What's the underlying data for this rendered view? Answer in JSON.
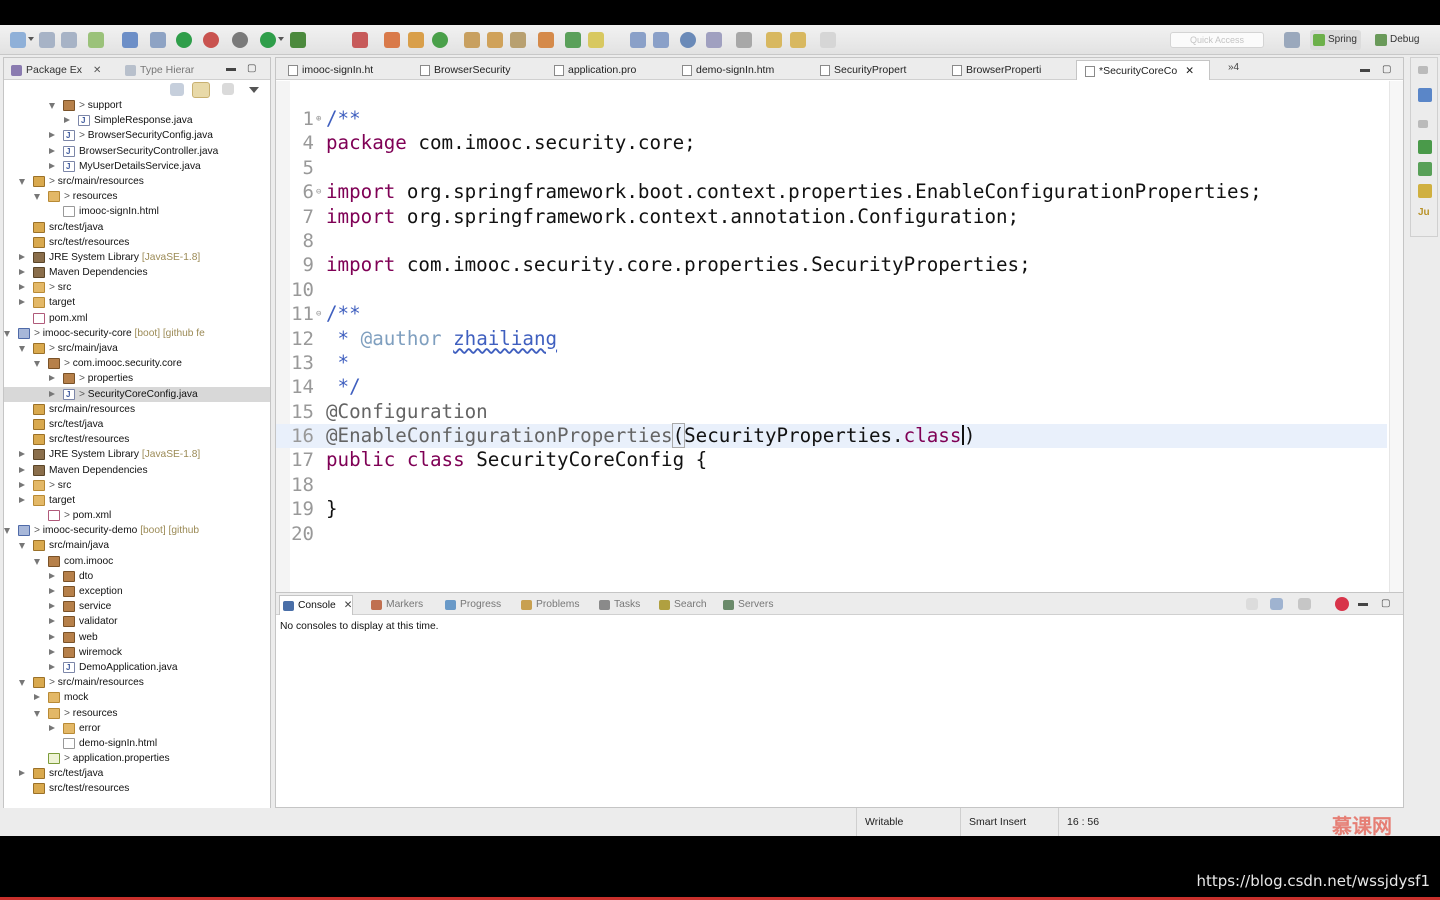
{
  "toolbar": {
    "quick_access_placeholder": "Quick Access",
    "perspectives": [
      {
        "label": "Spring",
        "icon": "spring-leaf-icon"
      },
      {
        "label": "Debug",
        "icon": "bug-icon"
      }
    ]
  },
  "package_explorer": {
    "tabs": [
      {
        "label": "Package Ex",
        "icon": "package-explorer-icon",
        "active": true
      },
      {
        "label": "Type Hierar",
        "icon": "type-hierarchy-icon",
        "active": false
      }
    ],
    "tree": [
      {
        "label": "support",
        "prefix": ">",
        "icon": "package",
        "twisty": "open",
        "level": 5,
        "sel": false,
        "decoration": ""
      },
      {
        "label": "SimpleResponse.java",
        "prefix": "",
        "icon": "java",
        "twisty": "closed",
        "level": 6,
        "sel": false,
        "decoration": ""
      },
      {
        "label": "BrowserSecurityConfig.java",
        "prefix": ">",
        "icon": "java",
        "twisty": "closed",
        "level": 5,
        "sel": false,
        "decoration": ""
      },
      {
        "label": "BrowserSecurityController.java",
        "prefix": "",
        "icon": "java",
        "twisty": "closed",
        "level": 5,
        "sel": false,
        "decoration": ""
      },
      {
        "label": "MyUserDetailsService.java",
        "prefix": "",
        "icon": "java",
        "twisty": "closed",
        "level": 5,
        "sel": false,
        "decoration": ""
      },
      {
        "label": "src/main/resources",
        "prefix": ">",
        "icon": "srcfolder",
        "twisty": "open",
        "level": 3,
        "sel": false,
        "decoration": ""
      },
      {
        "label": "resources",
        "prefix": ">",
        "icon": "folder",
        "twisty": "open",
        "level": 4,
        "sel": false,
        "decoration": ""
      },
      {
        "label": "imooc-signIn.html",
        "prefix": "",
        "icon": "html",
        "twisty": "",
        "level": 5,
        "sel": false,
        "decoration": ""
      },
      {
        "label": "src/test/java",
        "prefix": "",
        "icon": "srcfolder",
        "twisty": "",
        "level": 3,
        "sel": false,
        "decoration": ""
      },
      {
        "label": "src/test/resources",
        "prefix": "",
        "icon": "srcfolder",
        "twisty": "",
        "level": 3,
        "sel": false,
        "decoration": ""
      },
      {
        "label": "JRE System Library",
        "prefix": "",
        "icon": "library",
        "twisty": "closed",
        "level": 3,
        "sel": false,
        "decoration": "[JavaSE-1.8]"
      },
      {
        "label": "Maven Dependencies",
        "prefix": "",
        "icon": "library",
        "twisty": "closed",
        "level": 3,
        "sel": false,
        "decoration": ""
      },
      {
        "label": "src",
        "prefix": ">",
        "icon": "folder",
        "twisty": "closed",
        "level": 3,
        "sel": false,
        "decoration": ""
      },
      {
        "label": "target",
        "prefix": "",
        "icon": "folder",
        "twisty": "closed",
        "level": 3,
        "sel": false,
        "decoration": ""
      },
      {
        "label": "pom.xml",
        "prefix": "",
        "icon": "xml",
        "twisty": "",
        "level": 3,
        "sel": false,
        "decoration": ""
      },
      {
        "label": "imooc-security-core",
        "prefix": ">",
        "icon": "project",
        "twisty": "open",
        "level": 2,
        "sel": false,
        "decoration": "[boot] [github fe"
      },
      {
        "label": "src/main/java",
        "prefix": ">",
        "icon": "srcfolder",
        "twisty": "open",
        "level": 3,
        "sel": false,
        "decoration": ""
      },
      {
        "label": "com.imooc.security.core",
        "prefix": ">",
        "icon": "package",
        "twisty": "open",
        "level": 4,
        "sel": false,
        "decoration": ""
      },
      {
        "label": "properties",
        "prefix": ">",
        "icon": "package",
        "twisty": "closed",
        "level": 5,
        "sel": false,
        "decoration": ""
      },
      {
        "label": "SecurityCoreConfig.java",
        "prefix": ">",
        "icon": "java",
        "twisty": "closed",
        "level": 5,
        "sel": true,
        "decoration": ""
      },
      {
        "label": "src/main/resources",
        "prefix": "",
        "icon": "srcfolder",
        "twisty": "",
        "level": 3,
        "sel": false,
        "decoration": ""
      },
      {
        "label": "src/test/java",
        "prefix": "",
        "icon": "srcfolder",
        "twisty": "",
        "level": 3,
        "sel": false,
        "decoration": ""
      },
      {
        "label": "src/test/resources",
        "prefix": "",
        "icon": "srcfolder",
        "twisty": "",
        "level": 3,
        "sel": false,
        "decoration": ""
      },
      {
        "label": "JRE System Library",
        "prefix": "",
        "icon": "library",
        "twisty": "closed",
        "level": 3,
        "sel": false,
        "decoration": "[JavaSE-1.8]"
      },
      {
        "label": "Maven Dependencies",
        "prefix": "",
        "icon": "library",
        "twisty": "closed",
        "level": 3,
        "sel": false,
        "decoration": ""
      },
      {
        "label": "src",
        "prefix": ">",
        "icon": "folder",
        "twisty": "closed",
        "level": 3,
        "sel": false,
        "decoration": ""
      },
      {
        "label": "target",
        "prefix": "",
        "icon": "folder",
        "twisty": "closed",
        "level": 3,
        "sel": false,
        "decoration": ""
      },
      {
        "label": "pom.xml",
        "prefix": ">",
        "icon": "xml",
        "twisty": "",
        "level": 4,
        "sel": false,
        "decoration": ""
      },
      {
        "label": "imooc-security-demo",
        "prefix": ">",
        "icon": "project",
        "twisty": "open",
        "level": 2,
        "sel": false,
        "decoration": "[boot] [github"
      },
      {
        "label": "src/main/java",
        "prefix": "",
        "icon": "srcfolder",
        "twisty": "open",
        "level": 3,
        "sel": false,
        "decoration": ""
      },
      {
        "label": "com.imooc",
        "prefix": "",
        "icon": "package",
        "twisty": "open",
        "level": 4,
        "sel": false,
        "decoration": ""
      },
      {
        "label": "dto",
        "prefix": "",
        "icon": "package",
        "twisty": "closed",
        "level": 5,
        "sel": false,
        "decoration": ""
      },
      {
        "label": "exception",
        "prefix": "",
        "icon": "package",
        "twisty": "closed",
        "level": 5,
        "sel": false,
        "decoration": ""
      },
      {
        "label": "service",
        "prefix": "",
        "icon": "package",
        "twisty": "closed",
        "level": 5,
        "sel": false,
        "decoration": ""
      },
      {
        "label": "validator",
        "prefix": "",
        "icon": "package",
        "twisty": "closed",
        "level": 5,
        "sel": false,
        "decoration": ""
      },
      {
        "label": "web",
        "prefix": "",
        "icon": "package",
        "twisty": "closed",
        "level": 5,
        "sel": false,
        "decoration": ""
      },
      {
        "label": "wiremock",
        "prefix": "",
        "icon": "package",
        "twisty": "closed",
        "level": 5,
        "sel": false,
        "decoration": ""
      },
      {
        "label": "DemoApplication.java",
        "prefix": "",
        "icon": "java",
        "twisty": "closed",
        "level": 5,
        "sel": false,
        "decoration": ""
      },
      {
        "label": "src/main/resources",
        "prefix": ">",
        "icon": "srcfolder",
        "twisty": "open",
        "level": 3,
        "sel": false,
        "decoration": ""
      },
      {
        "label": "mock",
        "prefix": "",
        "icon": "folder",
        "twisty": "closed",
        "level": 4,
        "sel": false,
        "decoration": ""
      },
      {
        "label": "resources",
        "prefix": ">",
        "icon": "folder",
        "twisty": "open",
        "level": 4,
        "sel": false,
        "decoration": ""
      },
      {
        "label": "error",
        "prefix": "",
        "icon": "folder",
        "twisty": "closed",
        "level": 5,
        "sel": false,
        "decoration": ""
      },
      {
        "label": "demo-signIn.html",
        "prefix": "",
        "icon": "html",
        "twisty": "",
        "level": 5,
        "sel": false,
        "decoration": ""
      },
      {
        "label": "application.properties",
        "prefix": ">",
        "icon": "properties",
        "twisty": "",
        "level": 4,
        "sel": false,
        "decoration": ""
      },
      {
        "label": "src/test/java",
        "prefix": "",
        "icon": "srcfolder",
        "twisty": "closed",
        "level": 3,
        "sel": false,
        "decoration": ""
      },
      {
        "label": "src/test/resources",
        "prefix": "",
        "icon": "srcfolder",
        "twisty": "",
        "level": 3,
        "sel": false,
        "decoration": ""
      }
    ]
  },
  "editor": {
    "tabs": [
      {
        "label": "imooc-signIn.ht",
        "active": false
      },
      {
        "label": "BrowserSecurity",
        "active": false
      },
      {
        "label": "application.pro",
        "active": false
      },
      {
        "label": "demo-signIn.htm",
        "active": false
      },
      {
        "label": "SecurityPropert",
        "active": false
      },
      {
        "label": "BrowserProperti",
        "active": false
      },
      {
        "label": "*SecurityCoreCo",
        "active": true
      }
    ],
    "overflow_label": "»4",
    "lines": [
      {
        "num": "1",
        "fold": "⊕",
        "tokens": [
          {
            "t": "/**",
            "c": "cm"
          }
        ]
      },
      {
        "num": "4",
        "fold": "",
        "tokens": [
          {
            "t": "package",
            "c": "kw"
          },
          {
            "t": " com.imooc.security.core;",
            "c": ""
          }
        ]
      },
      {
        "num": "5",
        "fold": "",
        "tokens": []
      },
      {
        "num": "6",
        "fold": "⊖",
        "tokens": [
          {
            "t": "import",
            "c": "kw"
          },
          {
            "t": " org.springframework.boot.context.properties.EnableConfigurationProperties;",
            "c": ""
          }
        ]
      },
      {
        "num": "7",
        "fold": "",
        "tokens": [
          {
            "t": "import",
            "c": "kw"
          },
          {
            "t": " org.springframework.context.annotation.Configuration;",
            "c": ""
          }
        ]
      },
      {
        "num": "8",
        "fold": "",
        "tokens": []
      },
      {
        "num": "9",
        "fold": "",
        "tokens": [
          {
            "t": "import",
            "c": "kw"
          },
          {
            "t": " com.imooc.security.core.properties.SecurityProperties;",
            "c": ""
          }
        ]
      },
      {
        "num": "10",
        "fold": "",
        "tokens": []
      },
      {
        "num": "11",
        "fold": "⊖",
        "tokens": [
          {
            "t": "/**",
            "c": "cm"
          }
        ]
      },
      {
        "num": "12",
        "fold": "",
        "tokens": [
          {
            "t": " * ",
            "c": "cm"
          },
          {
            "t": "@author",
            "c": "tag"
          },
          {
            "t": " ",
            "c": "cm"
          },
          {
            "t": "zhailiang",
            "c": "author"
          }
        ]
      },
      {
        "num": "13",
        "fold": "",
        "tokens": [
          {
            "t": " *",
            "c": "cm"
          }
        ]
      },
      {
        "num": "14",
        "fold": "",
        "tokens": [
          {
            "t": " */",
            "c": "cm"
          }
        ]
      },
      {
        "num": "15",
        "fold": "",
        "tokens": [
          {
            "t": "@Configuration",
            "c": "at"
          }
        ]
      },
      {
        "num": "16",
        "fold": "",
        "cur": true,
        "tokens": [
          {
            "t": "@EnableConfigurationProperties",
            "c": "at"
          },
          {
            "t": "(",
            "c": "bracket"
          },
          {
            "t": "SecurityProperties.",
            "c": ""
          },
          {
            "t": "class",
            "c": "kw"
          },
          {
            "t": "CARET",
            "c": "caret"
          },
          {
            "t": ")",
            "c": ""
          }
        ]
      },
      {
        "num": "17",
        "fold": "",
        "tokens": [
          {
            "t": "public",
            "c": "kw"
          },
          {
            "t": " ",
            "c": ""
          },
          {
            "t": "class",
            "c": "kw"
          },
          {
            "t": " SecurityCoreConfig {",
            "c": ""
          }
        ]
      },
      {
        "num": "18",
        "fold": "",
        "tokens": []
      },
      {
        "num": "19",
        "fold": "",
        "tokens": [
          {
            "t": "}",
            "c": ""
          }
        ]
      },
      {
        "num": "20",
        "fold": "",
        "tokens": []
      }
    ]
  },
  "console": {
    "tabs": [
      {
        "label": "Console",
        "icon": "console-icon",
        "active": true
      },
      {
        "label": "Markers",
        "icon": "markers-icon",
        "active": false
      },
      {
        "label": "Progress",
        "icon": "progress-icon",
        "active": false
      },
      {
        "label": "Problems",
        "icon": "problems-icon",
        "active": false
      },
      {
        "label": "Tasks",
        "icon": "tasks-icon",
        "active": false
      },
      {
        "label": "Search",
        "icon": "search-icon",
        "active": false
      },
      {
        "label": "Servers",
        "icon": "servers-icon",
        "active": false
      }
    ],
    "message": "No consoles to display at this time."
  },
  "status": {
    "writable": "Writable",
    "insert_mode": "Smart Insert",
    "position": "16 : 56"
  },
  "overlay": {
    "logo_text": "慕课网",
    "url": "https://blog.csdn.net/wssjdysf1"
  }
}
